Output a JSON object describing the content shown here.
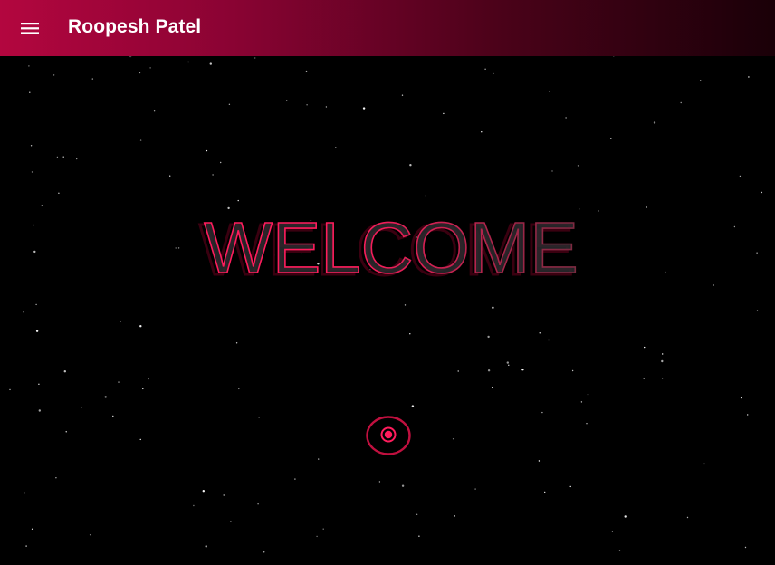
{
  "header": {
    "title": "Roopesh Patel",
    "menu_icon": "hamburger-menu-icon"
  },
  "hero": {
    "heading": "WELCOME"
  },
  "scroll_indicator": {
    "icon": "target-circle-icon"
  },
  "colors": {
    "accent": "#ff1c5c",
    "header_start": "#b3063f",
    "header_end": "#1a0008",
    "background": "#000000"
  }
}
